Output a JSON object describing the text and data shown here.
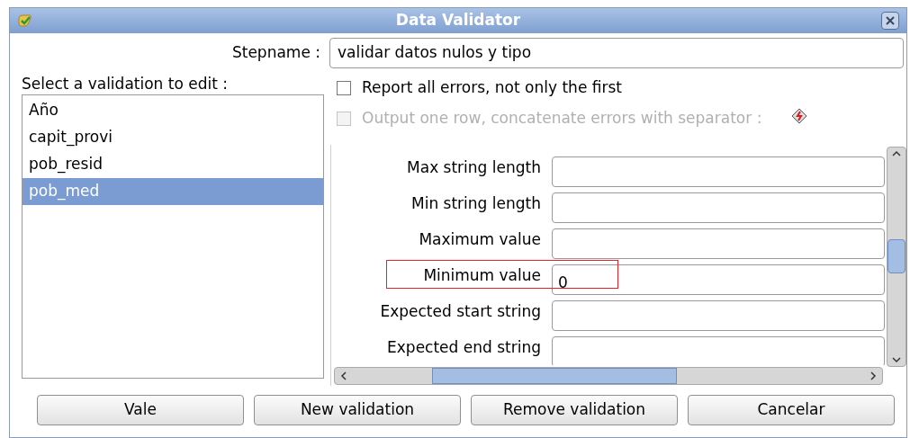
{
  "window": {
    "title": "Data Validator"
  },
  "stepname": {
    "label": "Stepname :",
    "value": "validar datos nulos y tipo"
  },
  "validations": {
    "label": "Select a validation to edit :",
    "items": [
      {
        "label": "Año",
        "selected": false
      },
      {
        "label": "capit_provi",
        "selected": false
      },
      {
        "label": "pob_resid",
        "selected": false
      },
      {
        "label": "pob_med",
        "selected": true
      }
    ]
  },
  "options": [
    {
      "label": "Report all errors, not only the first",
      "checked": false,
      "disabled": false
    },
    {
      "label": "Output one row, concatenate errors with separator :",
      "checked": false,
      "disabled": true
    }
  ],
  "fields": [
    {
      "label": "Max string length",
      "highlighted": false
    },
    {
      "label": "Min string length",
      "highlighted": false
    },
    {
      "label": "Maximum value",
      "highlighted": false
    },
    {
      "label": "Minimum value",
      "value": "0",
      "highlighted": true
    },
    {
      "label": "Expected start string",
      "highlighted": false
    },
    {
      "label": "Expected end string",
      "highlighted": false
    }
  ],
  "buttons": [
    "Vale",
    "New validation",
    "Remove validation",
    "Cancelar"
  ]
}
